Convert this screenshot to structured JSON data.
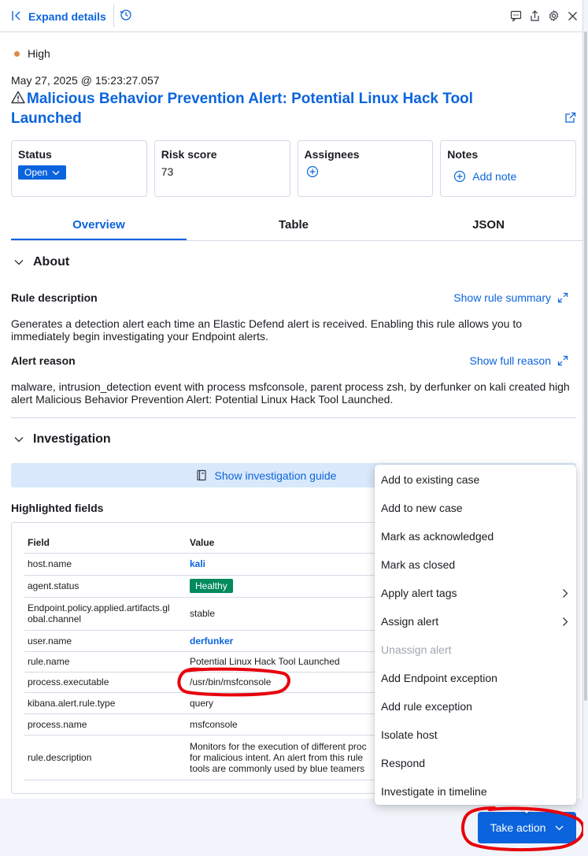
{
  "header": {
    "expand_label": "Expand details"
  },
  "alert": {
    "severity": "High",
    "timestamp": "May 27, 2025 @ 15:23:27.057",
    "title": "Malicious Behavior Prevention Alert: Potential Linux Hack Tool Launched"
  },
  "cards": {
    "status_title": "Status",
    "status_value": "Open",
    "risk_title": "Risk score",
    "risk_value": "73",
    "assignees_title": "Assignees",
    "notes_title": "Notes",
    "add_note": "Add note"
  },
  "tabs": [
    {
      "label": "Overview",
      "active": true
    },
    {
      "label": "Table",
      "active": false
    },
    {
      "label": "JSON",
      "active": false
    }
  ],
  "about": {
    "heading": "About",
    "rule_description_label": "Rule description",
    "show_rule_summary": "Show rule summary",
    "rule_description": "Generates a detection alert each time an Elastic Defend alert is received. Enabling this rule allows you to immediately begin investigating your Endpoint alerts.",
    "alert_reason_label": "Alert reason",
    "show_full_reason": "Show full reason",
    "alert_reason": "malware, intrusion_detection event with process msfconsole, parent process zsh, by derfunker on kali created high alert Malicious Behavior Prevention Alert: Potential Linux Hack Tool Launched."
  },
  "investigation": {
    "heading": "Investigation",
    "guide_button": "Show investigation guide",
    "highlighted_title": "Highlighted fields",
    "col_field": "Field",
    "col_value": "Value",
    "rows": [
      {
        "field": "host.name",
        "value": "kali"
      },
      {
        "field": "agent.status",
        "value": "Healthy"
      },
      {
        "field": "Endpoint.policy.applied.artifacts.gl",
        "field2": "obal.channel",
        "value": "stable"
      },
      {
        "field": "user.name",
        "value": "derfunker"
      },
      {
        "field": "rule.name",
        "value": "Potential Linux Hack Tool Launched"
      },
      {
        "field": "process.executable",
        "value": "/usr/bin/msfconsole"
      },
      {
        "field": "kibana.alert.rule.type",
        "value": "query"
      },
      {
        "field": "process.name",
        "value": "msfconsole"
      },
      {
        "field": "rule.description",
        "value": "Monitors for the execution of different proc",
        "value2": "for malicious intent. An alert from this rule",
        "value3": "tools are commonly used by blue teamers"
      }
    ]
  },
  "menu": {
    "items": [
      {
        "label": "Add to existing case",
        "submenu": false,
        "disabled": false
      },
      {
        "label": "Add to new case",
        "submenu": false,
        "disabled": false
      },
      {
        "label": "Mark as acknowledged",
        "submenu": false,
        "disabled": false
      },
      {
        "label": "Mark as closed",
        "submenu": false,
        "disabled": false
      },
      {
        "label": "Apply alert tags",
        "submenu": true,
        "disabled": false
      },
      {
        "label": "Assign alert",
        "submenu": true,
        "disabled": false
      },
      {
        "label": "Unassign alert",
        "submenu": false,
        "disabled": true
      },
      {
        "label": "Add Endpoint exception",
        "submenu": false,
        "disabled": false
      },
      {
        "label": "Add rule exception",
        "submenu": false,
        "disabled": false
      },
      {
        "label": "Isolate host",
        "submenu": false,
        "disabled": false
      },
      {
        "label": "Respond",
        "submenu": false,
        "disabled": false
      },
      {
        "label": "Investigate in timeline",
        "submenu": false,
        "disabled": false
      }
    ]
  },
  "footer": {
    "take_action": "Take action"
  },
  "colors": {
    "primary": "#0b64dd",
    "severity_high": "#da8b45",
    "healthy": "#008a5e",
    "annotation": "#e8000b"
  }
}
